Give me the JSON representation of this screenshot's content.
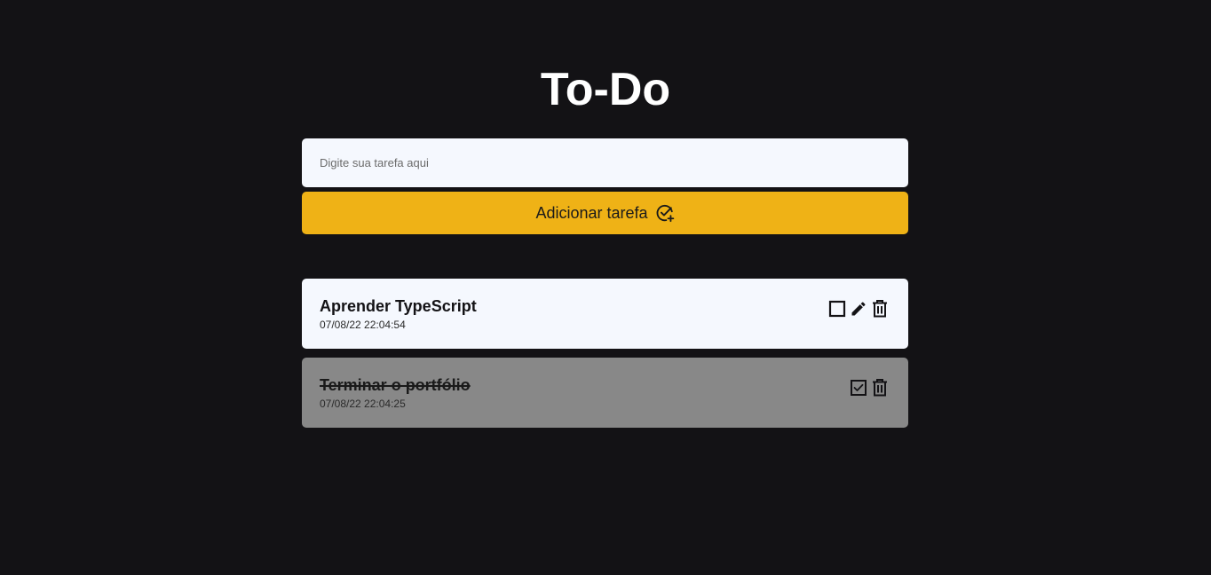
{
  "app": {
    "title": "To-Do"
  },
  "new_task": {
    "placeholder": "Digite sua tarefa aqui",
    "value": ""
  },
  "add_button": {
    "label": "Adicionar tarefa",
    "icon": "check-circle-plus-icon"
  },
  "colors": {
    "background": "#131215",
    "accent": "#efb216",
    "card": "#f5f8fe",
    "card_done": "#888888"
  },
  "tasks": [
    {
      "title": "Aprender TypeScript",
      "date": "07/08/22 22:04:54",
      "completed": false,
      "icons": [
        "checkbox-unchecked-icon",
        "pencil-icon",
        "trash-icon"
      ]
    },
    {
      "title": "Terminar o portfólio",
      "date": "07/08/22 22:04:25",
      "completed": true,
      "icons": [
        "checkbox-checked-icon",
        "trash-icon"
      ]
    }
  ]
}
